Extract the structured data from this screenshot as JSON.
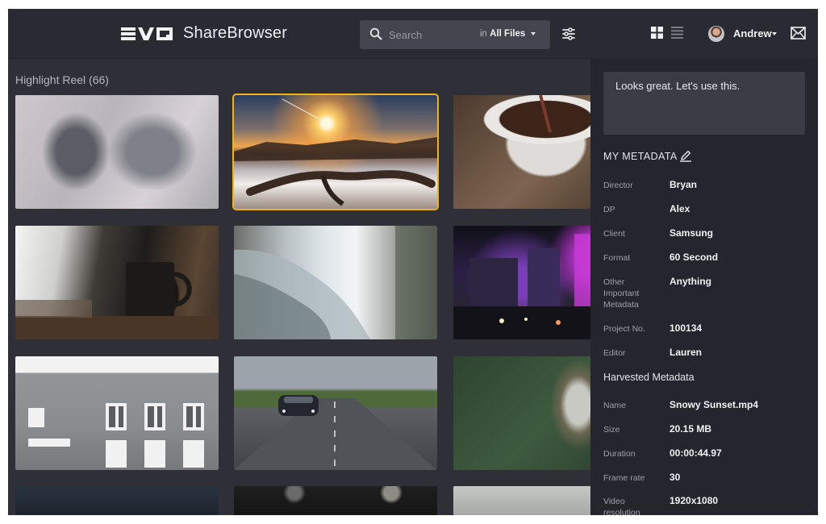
{
  "header": {
    "logo_text": "EVO",
    "app_title": "ShareBrowser",
    "search": {
      "placeholder": "Search",
      "scope_prefix": "in",
      "scope_value": "All Files"
    },
    "user": {
      "name": "Andrew"
    },
    "icons": {
      "search": "search-icon",
      "filter": "sliders-icon",
      "grid": "grid-view-icon",
      "list": "list-view-icon",
      "mail": "mail-icon"
    }
  },
  "gallery": {
    "title": "Highlight Reel (66)",
    "selected_index": 1,
    "highlight_color": "#f1b318"
  },
  "panel": {
    "comment": "Looks great. Let's use this.",
    "my_metadata": {
      "title": "MY METADATA",
      "fields": [
        {
          "label": "Director",
          "value": "Bryan"
        },
        {
          "label": "DP",
          "value": "Alex"
        },
        {
          "label": "Client",
          "value": "Samsung"
        },
        {
          "label": "Format",
          "value": "60 Second"
        },
        {
          "label": "Other Important Metadata",
          "value": "Anything"
        },
        {
          "label": "Project No.",
          "value": "100134"
        },
        {
          "label": "Editor",
          "value": "Lauren"
        }
      ]
    },
    "harvested_metadata": {
      "title": "Harvested Metadata",
      "fields": [
        {
          "label": "Name",
          "value": "Snowy Sunset.mp4"
        },
        {
          "label": "Size",
          "value": "20.15 MB"
        },
        {
          "label": "Duration",
          "value": "00:00:44.97"
        },
        {
          "label": "Frame rate",
          "value": "30"
        },
        {
          "label": "Video resolution",
          "value": "1920x1080"
        }
      ]
    }
  }
}
